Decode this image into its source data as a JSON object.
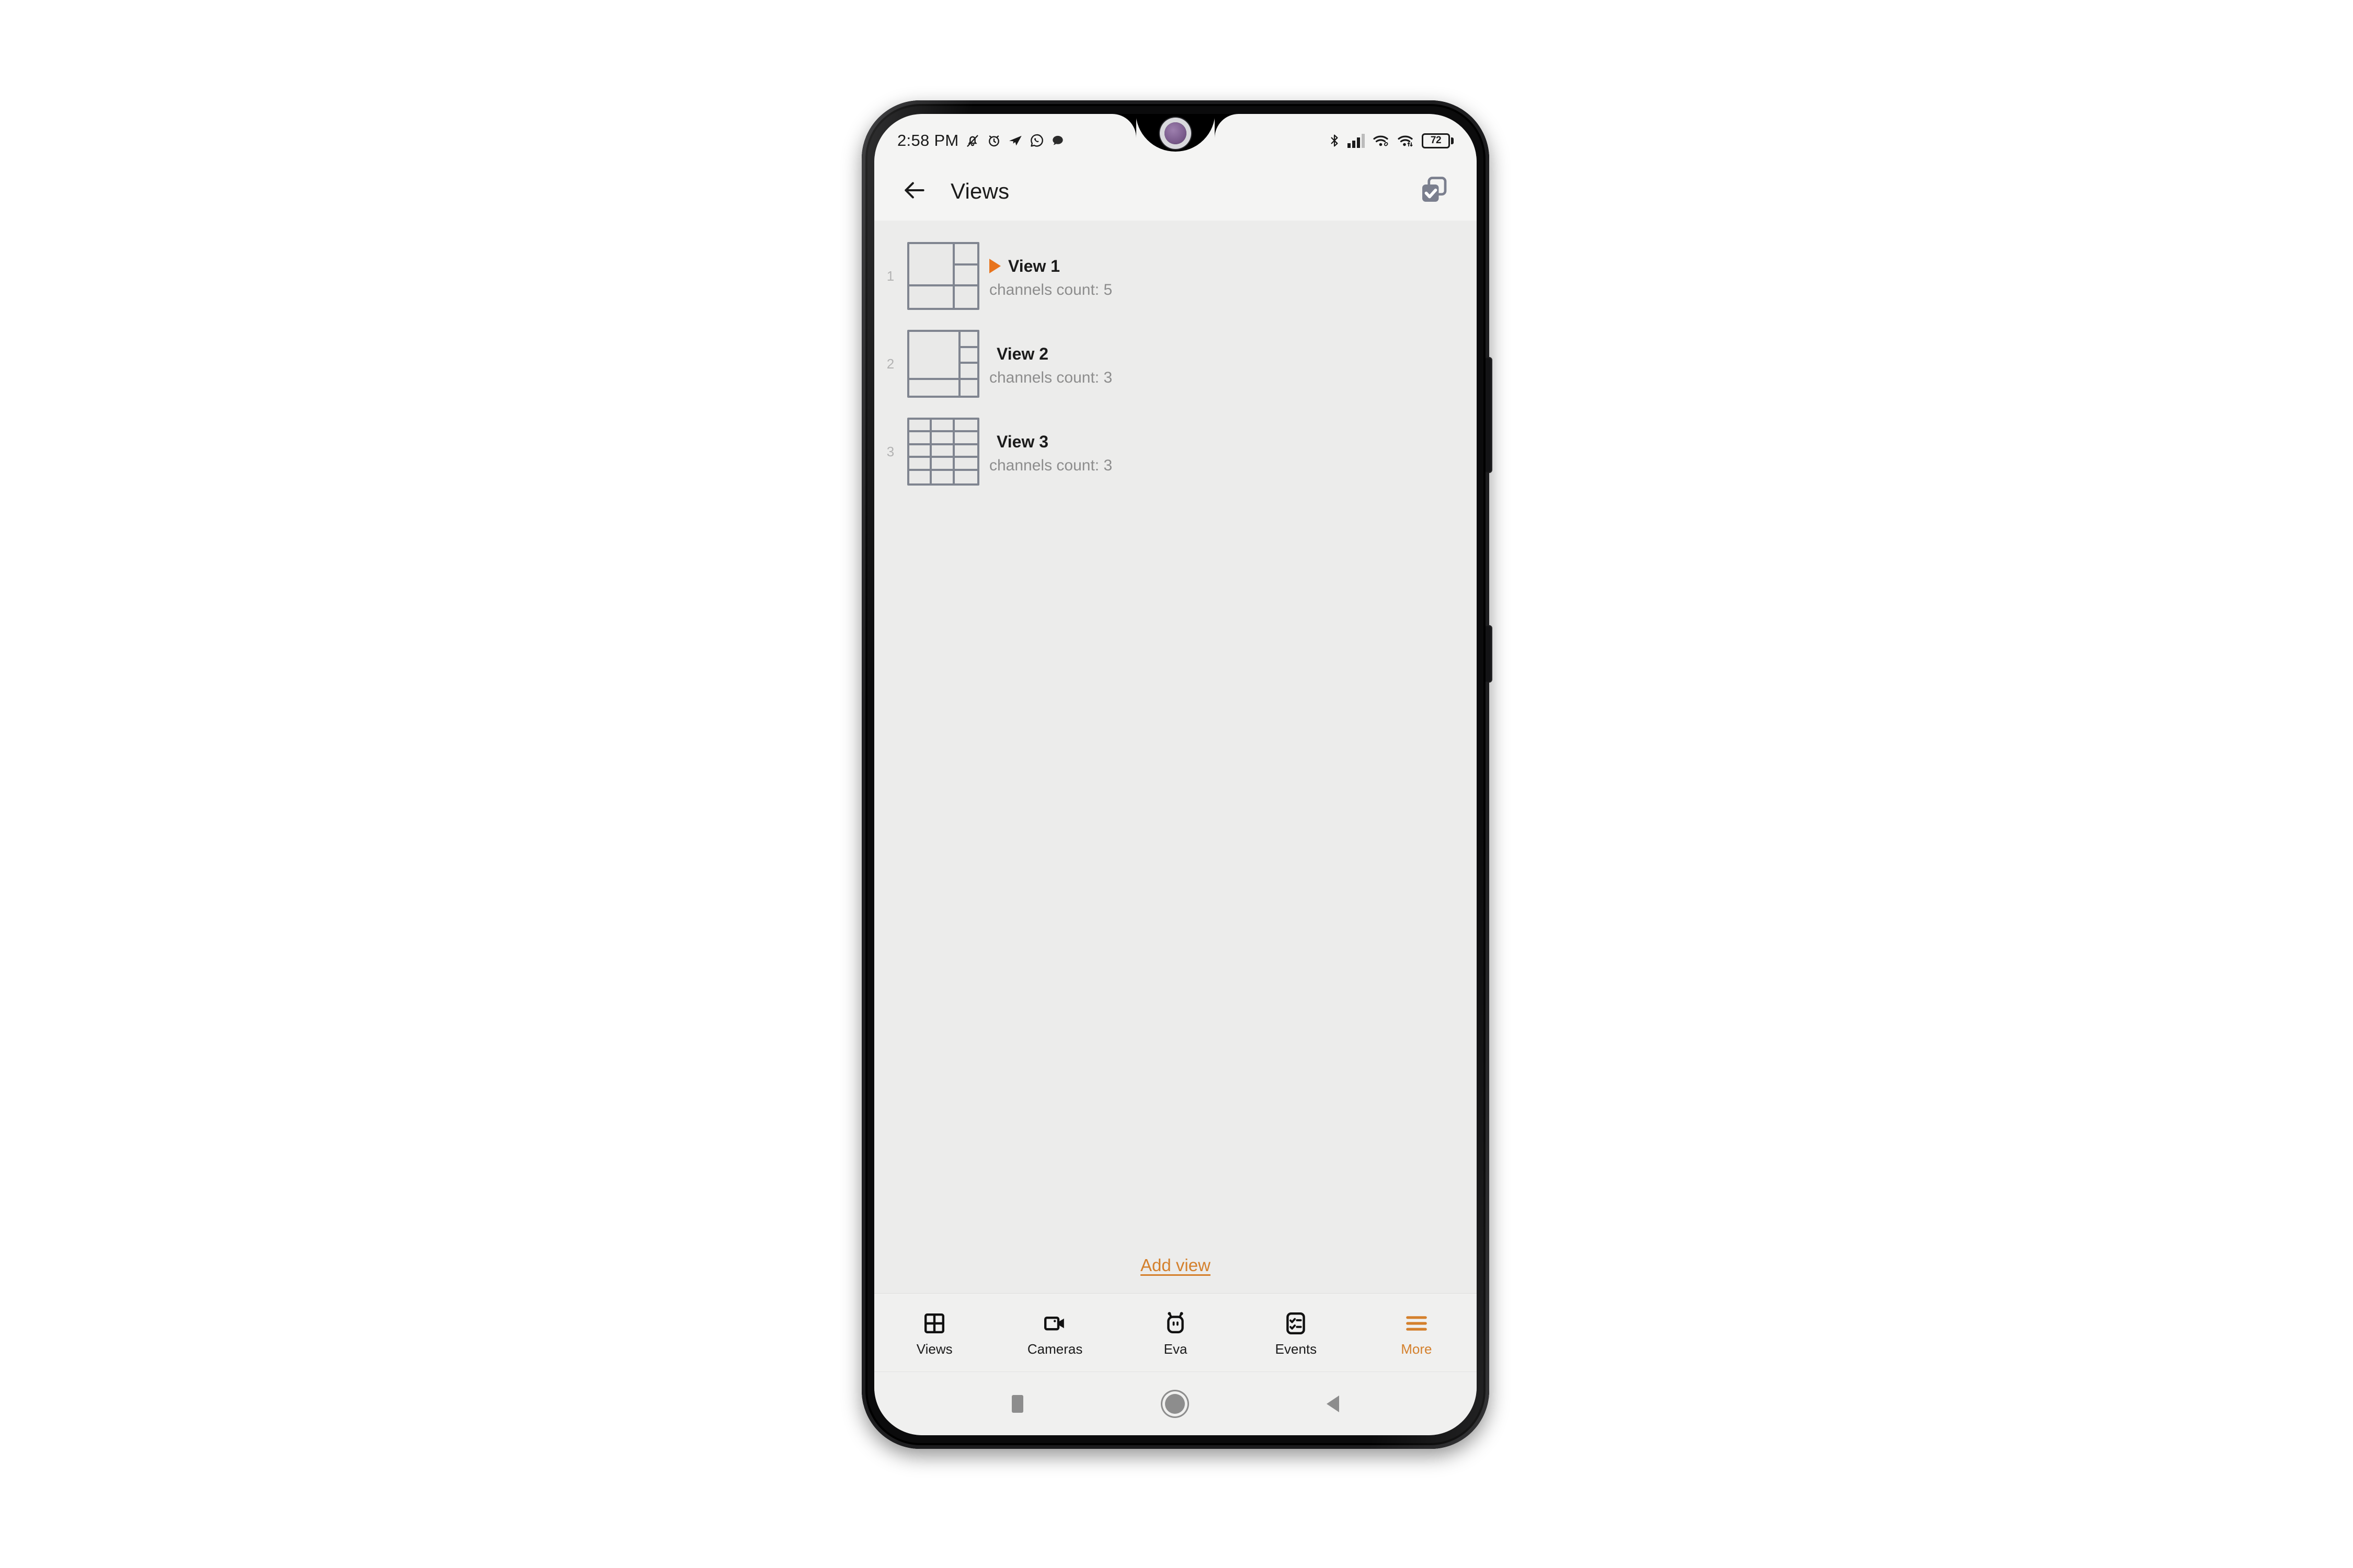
{
  "device": {
    "notch_style": "waterdrop",
    "camera_tint": "#7e5f90",
    "frame_color": "#0b0b0c"
  },
  "statusbar": {
    "time": "2:58 PM",
    "left_icons": [
      "bell-mute-icon",
      "alarm-clock-icon",
      "telegram-icon",
      "whatsapp-icon",
      "chat-bubble-icon"
    ],
    "right_icons": [
      "bluetooth-icon",
      "signal-bars-icon",
      "wifi-link-icon",
      "wifi-data-icon"
    ],
    "signal_bars_filled": 3,
    "signal_bars_total": 4,
    "battery_level": "72"
  },
  "appbar": {
    "back_icon": "arrow-left-icon",
    "title": "Views",
    "action_icon": "multi-select-check-icon"
  },
  "colors": {
    "accent": "#d4802c",
    "play_marker": "#e8741c",
    "screen_bg": "#ececeb",
    "appbar_bg": "#f4f4f3",
    "thumb_stroke": "#808590",
    "index_text": "#b3b3b3",
    "subtitle_text": "#8d8d8d"
  },
  "views": {
    "items": [
      {
        "index": "1",
        "title": "View 1",
        "subtitle": "channels count: 5",
        "playing": true,
        "layout_class": "lay-1",
        "layout_name": "1 large left + 2 right stacked + 3 bottom"
      },
      {
        "index": "2",
        "title": "View 2",
        "subtitle": "channels count: 3",
        "playing": false,
        "layout_class": "lay-2",
        "layout_name": "1 large left + 3 right stacked + 4 bottom"
      },
      {
        "index": "3",
        "title": "View 3",
        "subtitle": "channels count: 3",
        "playing": false,
        "layout_class": "lay-3",
        "layout_name": "uniform 3 x 5 grid"
      }
    ],
    "add_view_label": "Add view"
  },
  "bottomnav": {
    "items": [
      {
        "label": "Views",
        "icon": "grid-view-icon",
        "active": false
      },
      {
        "label": "Cameras",
        "icon": "video-camera-icon",
        "active": false
      },
      {
        "label": "Eva",
        "icon": "robot-head-icon",
        "active": false
      },
      {
        "label": "Events",
        "icon": "checklist-icon",
        "active": false
      },
      {
        "label": "More",
        "icon": "hamburger-menu-icon",
        "active": true
      }
    ]
  },
  "androidbar": {
    "buttons": [
      "recents-square-icon",
      "home-circle-icon",
      "back-triangle-icon"
    ]
  }
}
